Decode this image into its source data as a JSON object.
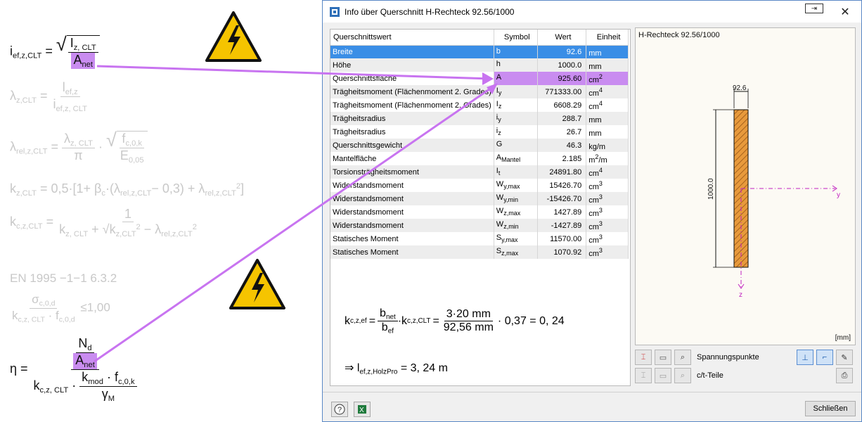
{
  "dialog": {
    "title": "Info über Querschnitt H-Rechteck 92.56/1000",
    "close_button": "Schließen"
  },
  "table": {
    "headers": [
      "Querschnittswert",
      "Symbol",
      "Wert",
      "Einheit"
    ],
    "rows": [
      {
        "name": "Breite",
        "symbol": "b",
        "symbol_sub": "",
        "value": "92.6",
        "unit": "mm",
        "unit_sup": ""
      },
      {
        "name": "Höhe",
        "symbol": "h",
        "symbol_sub": "",
        "value": "1000.0",
        "unit": "mm",
        "unit_sup": ""
      },
      {
        "name": "Querschnittsfläche",
        "symbol": "A",
        "symbol_sub": "",
        "value": "925.60",
        "unit": "cm",
        "unit_sup": "2"
      },
      {
        "name": "Trägheitsmoment (Flächenmoment 2. Grades)",
        "symbol": "I",
        "symbol_sub": "y",
        "value": "771333.00",
        "unit": "cm",
        "unit_sup": "4"
      },
      {
        "name": "Trägheitsmoment (Flächenmoment 2. Grades)",
        "symbol": "I",
        "symbol_sub": "z",
        "value": "6608.29",
        "unit": "cm",
        "unit_sup": "4"
      },
      {
        "name": "Trägheitsradius",
        "symbol": "i",
        "symbol_sub": "y",
        "value": "288.7",
        "unit": "mm",
        "unit_sup": ""
      },
      {
        "name": "Trägheitsradius",
        "symbol": "i",
        "symbol_sub": "z",
        "value": "26.7",
        "unit": "mm",
        "unit_sup": ""
      },
      {
        "name": "Querschnittsgewicht",
        "symbol": "G",
        "symbol_sub": "",
        "value": "46.3",
        "unit": "kg/m",
        "unit_sup": ""
      },
      {
        "name": "Mantelfläche",
        "symbol": "A",
        "symbol_sub": "Mantel",
        "value": "2.185",
        "unit": "m",
        "unit_sup": "2",
        "unit_suffix": "/m"
      },
      {
        "name": "Torsionsträgheitsmoment",
        "symbol": "I",
        "symbol_sub": "t",
        "value": "24891.80",
        "unit": "cm",
        "unit_sup": "4"
      },
      {
        "name": "Widerstandsmoment",
        "symbol": "W",
        "symbol_sub": "y,max",
        "value": "15426.70",
        "unit": "cm",
        "unit_sup": "3"
      },
      {
        "name": "Widerstandsmoment",
        "symbol": "W",
        "symbol_sub": "y,min",
        "value": "-15426.70",
        "unit": "cm",
        "unit_sup": "3"
      },
      {
        "name": "Widerstandsmoment",
        "symbol": "W",
        "symbol_sub": "z,max",
        "value": "1427.89",
        "unit": "cm",
        "unit_sup": "3"
      },
      {
        "name": "Widerstandsmoment",
        "symbol": "W",
        "symbol_sub": "z,min",
        "value": "-1427.89",
        "unit": "cm",
        "unit_sup": "3"
      },
      {
        "name": "Statisches Moment",
        "symbol": "S",
        "symbol_sub": "y,max",
        "value": "11570.00",
        "unit": "cm",
        "unit_sup": "3"
      },
      {
        "name": "Statisches Moment",
        "symbol": "S",
        "symbol_sub": "z,max",
        "value": "1070.92",
        "unit": "cm",
        "unit_sup": "3"
      }
    ]
  },
  "preview": {
    "title": "H-Rechteck 92.56/1000",
    "width_label": "92.6",
    "height_label": "1000.0",
    "axis_y": "y",
    "axis_z": "z",
    "unit": "[mm]"
  },
  "toolbar": {
    "row1_label": "Spannungspunkte",
    "row2_label": "c/t-Teile"
  },
  "formulas": {
    "kc_line": {
      "lhs": "k",
      "lhs_sub": "c,z,ef",
      "b_net": "b",
      "b_net_sub": "net",
      "b_ef": "b",
      "b_ef_sub": "ef",
      "k_clt": "k",
      "k_clt_sub": "c,z,CLT",
      "num": "3·20 mm",
      "den": "92,56 mm",
      "tail": "· 0,37 = 0, 24"
    },
    "lef_line": {
      "arrow": "⇒",
      "l": "l",
      "l_sub": "ef,z,HolzPro",
      "rhs": "= 3, 24 m"
    }
  },
  "left": {
    "i_line": {
      "lhs": "i",
      "lhs_sub": "ef,z,CLT",
      "num": "I",
      "num_sub": "z, CLT",
      "den": "A",
      "den_sub": "net"
    },
    "lambda_line": {
      "lhs": "λ",
      "lhs_sub": "z,CLT",
      "num": "l",
      "num_sub": "ef,z",
      "den": "i",
      "den_sub": "ef,z, CLT"
    },
    "lambda_rel_line": {
      "lhs": "λ",
      "lhs_sub": "rel,z,CLT",
      "num": "λ",
      "num_sub": "z, CLT",
      "den": "π",
      "sq_num": "f",
      "sq_num_sub": "c,0,k",
      "sq_den": "E",
      "sq_den_sub": "0,05"
    },
    "k_line": "k",
    "k_line_sub": "z,CLT",
    "k_line_rhs": "= 0,5·[1+ β",
    "k_line_beta_sub": "c",
    "k_line_mid": "·(λ",
    "k_line_lam_sub": "rel,z,CLT",
    "k_line_tail": "− 0,3) + λ",
    "k_line_tail_sub": "rel,z,CLT",
    "k_line_tail_sup": "2",
    "k_line_end": "]",
    "kc_line": {
      "lhs": "k",
      "lhs_sub": "c,z,CLT",
      "num": "1",
      "den_a": "k",
      "den_a_sub": "z, CLT",
      "den_b": "k",
      "den_b_sub": "z,CLT",
      "den_c": "λ",
      "den_c_sub": "rel,z,CLT",
      "den_sup": "2"
    },
    "en_ref": "EN 1995 −1−1  6.3.2",
    "sigma_line": {
      "num": "σ",
      "num_sub": "c,0,d",
      "den_a": "k",
      "den_a_sub": "c,z, CLT",
      "den_b": "f",
      "den_b_sub": "c,0,d",
      "rhs": "≤1,00"
    },
    "eta_line": {
      "lhs": "η =",
      "n": "N",
      "n_sub": "d",
      "a": "A",
      "a_sub": "net",
      "den_a": "k",
      "den_a_sub": "c,z, CLT",
      "kmod": "k",
      "kmod_sub": "mod",
      "fc": "f",
      "fc_sub": "c,0,k",
      "gamma": "γ",
      "gamma_sub": "M"
    }
  },
  "colors": {
    "highlight": "#c98cf0",
    "arrow": "#c874f0",
    "selection": "#3a8ee6",
    "hatch": "#d97a1e",
    "axis": "#c020c0"
  }
}
